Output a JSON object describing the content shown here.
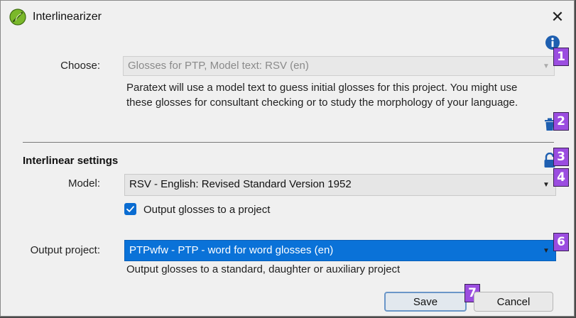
{
  "window": {
    "title": "Interlinearizer",
    "close_glyph": "✕"
  },
  "choose": {
    "label": "Choose:",
    "value": "Glosses for PTP, Model text: RSV (en)",
    "description_line1": "Paratext will use a model text to guess initial glosses for this project. You might use",
    "description_line2": "these glosses for consultant checking or to study the morphology of your language."
  },
  "section": {
    "heading": "Interlinear settings"
  },
  "model": {
    "label": "Model:",
    "value": "RSV - English: Revised Standard Version 1952"
  },
  "output_checkbox": {
    "label": "Output glosses to a project",
    "checked": true
  },
  "output_project": {
    "label": "Output project:",
    "value": "PTPwfw - PTP - word for word glosses (en)",
    "hint": "Output glosses to a standard, daughter or auxiliary project"
  },
  "buttons": {
    "save_label": "Save",
    "cancel_label": "Cancel"
  },
  "badges": [
    "1",
    "2",
    "3",
    "4",
    "6",
    "7"
  ],
  "icons": {
    "app": "leaf-icon",
    "info": "info-icon",
    "delete": "trash-icon",
    "lock": "unlock-icon",
    "dropdown": "chevron-down-icon"
  },
  "colors": {
    "badge": "#9b4de0",
    "selection": "#0a72d8",
    "icon_blue": "#1e5fb0",
    "app_icon": "#7ab82a"
  }
}
